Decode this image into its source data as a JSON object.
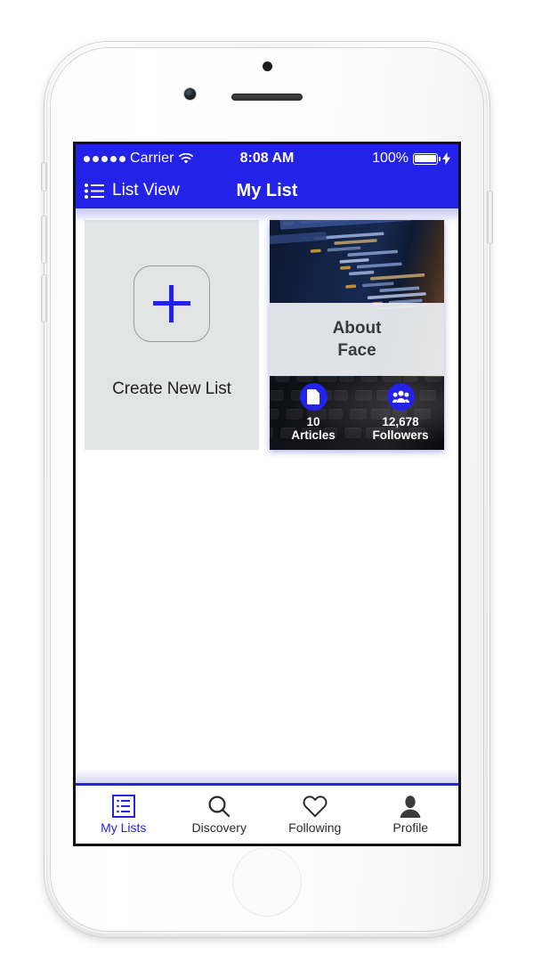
{
  "theme": {
    "brand_blue": "#2222e8",
    "card_grey": "#e3e4e4",
    "title_band": "#eef0f2",
    "tab_inactive": "#2b2b2b"
  },
  "status_bar": {
    "signal_icon": "signal-dots-icon",
    "carrier": "Carrier",
    "wifi_icon": "wifi-icon",
    "time": "8:08 AM",
    "battery_percent": "100%",
    "battery_icon": "battery-full-icon",
    "charging_icon": "lightning-bolt-icon",
    "battery_level": 100
  },
  "nav_bar": {
    "left_icon": "bulleted-list-icon",
    "left_label": "List View",
    "title": "My List"
  },
  "content": {
    "create_card": {
      "icon": "plus-icon",
      "label": "Create New List"
    },
    "list_card": {
      "cover_image": "code-editor-photo",
      "title_line_1": "About",
      "title_line_2": "Face",
      "stats": [
        {
          "icon": "document-icon",
          "value": "10",
          "label": "Articles"
        },
        {
          "icon": "people-group-icon",
          "value": "12,678",
          "label": "Followers"
        }
      ]
    }
  },
  "tab_bar": {
    "tabs": [
      {
        "icon": "list-box-icon",
        "label": "My Lists",
        "active": true
      },
      {
        "icon": "magnifier-icon",
        "label": "Discovery",
        "active": false
      },
      {
        "icon": "heart-icon",
        "label": "Following",
        "active": false
      },
      {
        "icon": "person-icon",
        "label": "Profile",
        "active": false
      }
    ]
  }
}
